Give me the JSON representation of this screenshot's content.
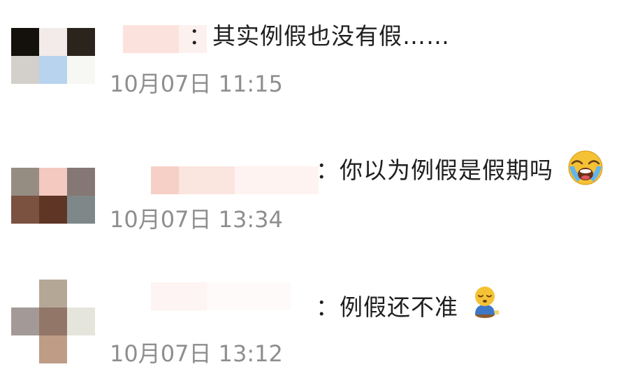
{
  "comments": [
    {
      "avatar_colors": [
        "#14110d",
        "#f3eaea",
        "#2a241d",
        "#d3d0cb",
        "#b7d3ee",
        "#f7f8f3",
        "#ffffff",
        "#ffffff",
        "#ffffff"
      ],
      "name_colors": [
        "#fce2dd",
        "#fdf1ef"
      ],
      "text": "：其实例假也没有假……",
      "date": "10月07日",
      "time": "11:15"
    },
    {
      "avatar_colors": [
        "#968d82",
        "#f3c9c0",
        "#857874",
        "#7b5140",
        "#5f3526",
        "#7f8889",
        "#ffffff",
        "#ffffff",
        "#ffffff"
      ],
      "name_colors": [
        "#f6d0c6",
        "#fbe5df",
        "#fff3f1"
      ],
      "text": "：你以为例假是假期吗",
      "emoji": "loudly-crying-face-icon",
      "date": "10月07日",
      "time": "13:34"
    },
    {
      "avatar_colors": [
        "#ffffff",
        "#b4a796",
        "#ffffff",
        "#a39a97",
        "#927667",
        "#e6e5dc",
        "#ffffff",
        "#bf9c85",
        "#ffffff"
      ],
      "name_colors": [
        "#fdf4f3",
        "#fefaf9"
      ],
      "text": "：例假还不准",
      "emoji": "sleepy-person-icon",
      "date": "10月07日",
      "time": "13:12"
    }
  ]
}
